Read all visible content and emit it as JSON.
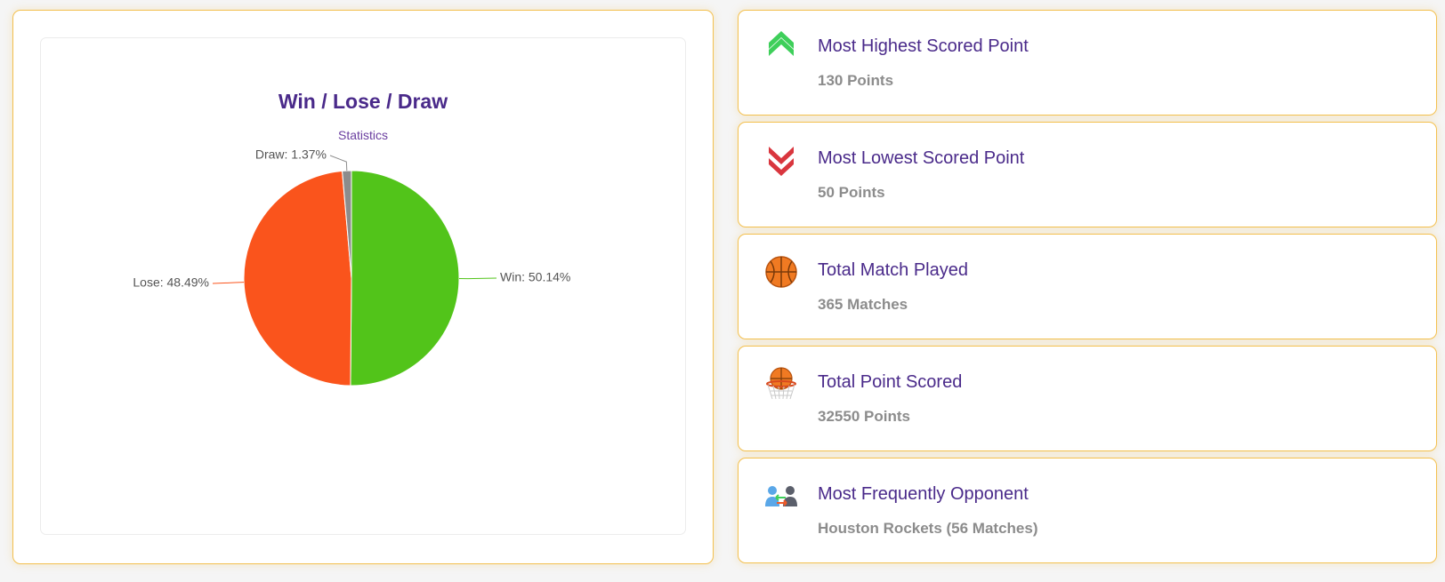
{
  "chart_data": {
    "type": "pie",
    "title": "Win / Lose / Draw",
    "subtitle": "Statistics",
    "slices": [
      {
        "name": "Win",
        "value": 50.14,
        "label": "Win: 50.14%",
        "color": "#52c41a"
      },
      {
        "name": "Lose",
        "value": 48.49,
        "label": "Lose: 48.49%",
        "color": "#fa541c"
      },
      {
        "name": "Draw",
        "value": 1.37,
        "label": "Draw: 1.37%",
        "color": "#8c8c8c"
      }
    ]
  },
  "stats": [
    {
      "icon": "double-chevron-up-icon",
      "title": "Most Highest Scored Point",
      "value": "130 Points"
    },
    {
      "icon": "double-chevron-down-icon",
      "title": "Most Lowest Scored Point",
      "value": "50 Points"
    },
    {
      "icon": "basketball-icon",
      "title": "Total Match Played",
      "value": "365 Matches"
    },
    {
      "icon": "basketball-hoop-icon",
      "title": "Total Point Scored",
      "value": "32550 Points"
    },
    {
      "icon": "opponents-icon",
      "title": "Most Frequently Opponent",
      "value": "Houston Rockets (56 Matches)"
    }
  ],
  "colors": {
    "accent_border": "#f3c04f",
    "title_purple": "#4a2a8a",
    "value_gray": "#8c8c8c"
  }
}
